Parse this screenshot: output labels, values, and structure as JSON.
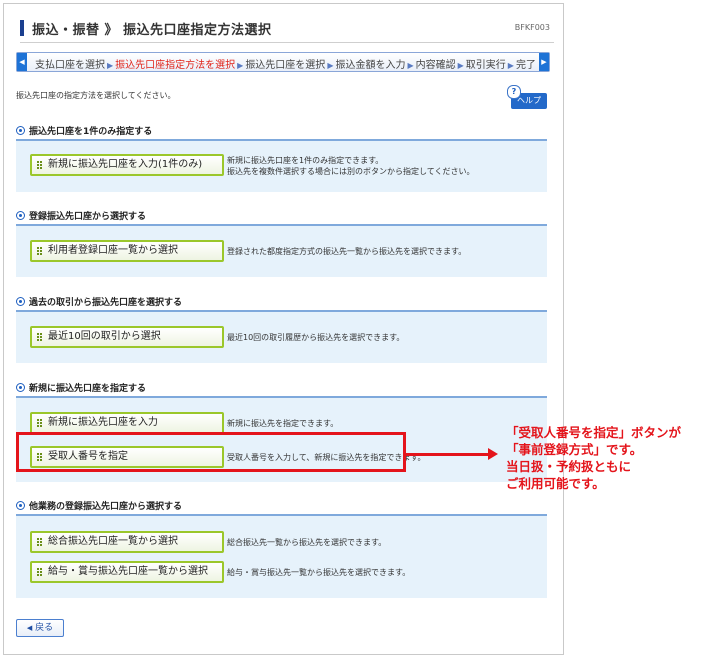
{
  "header": {
    "title": "振込・振替 》 振込先口座指定方法選択",
    "screen_id": "BFKF003"
  },
  "steps": {
    "items": [
      "支払口座を選択",
      "振込先口座指定方法を選択",
      "振込先口座を選択",
      "振込金額を入力",
      "内容確認",
      "取引実行",
      "完了"
    ],
    "current_index": 1,
    "left_arrow": "◀",
    "right_arrow": "▶"
  },
  "instruction": "振込先口座の指定方法を選択してください。",
  "help": {
    "icon_label": "?",
    "label": "ヘルプ"
  },
  "sections": [
    {
      "heading": "振込先口座を1件のみ指定する",
      "options": [
        {
          "label": "新規に振込先口座を入力(1件のみ)",
          "desc_lines": [
            "新規に振込先口座を1件のみ指定できます。",
            "振込先を複数件選択する場合には別のボタンから指定してください。"
          ]
        }
      ]
    },
    {
      "heading": "登録振込先口座から選択する",
      "options": [
        {
          "label": "利用者登録口座一覧から選択",
          "desc_lines": [
            "登録された都度指定方式の振込先一覧から振込先を選択できます。"
          ]
        }
      ]
    },
    {
      "heading": "過去の取引から振込先口座を選択する",
      "options": [
        {
          "label": "最近10回の取引から選択",
          "desc_lines": [
            "最近10回の取引履歴から振込先を選択できます。"
          ]
        }
      ]
    },
    {
      "heading": "新規に振込先口座を指定する",
      "options": [
        {
          "label": "新規に振込先口座を入力",
          "desc_lines": [
            "新規に振込先を指定できます。"
          ]
        },
        {
          "label": "受取人番号を指定",
          "desc_lines": [
            "受取人番号を入力して、新規に振込先を指定できます。"
          ]
        }
      ]
    },
    {
      "heading": "他業務の登録振込先口座から選択する",
      "options": [
        {
          "label": "総合振込先口座一覧から選択",
          "desc_lines": [
            "総合振込先一覧から振込先を選択できます。"
          ]
        },
        {
          "label": "給与・賞与振込先口座一覧から選択",
          "desc_lines": [
            "給与・賞与振込先一覧から振込先を選択できます。"
          ]
        }
      ]
    }
  ],
  "back": {
    "icon": "◀",
    "label": "戻る"
  },
  "annotation": {
    "lines": [
      "「受取人番号を指定」ボタンが",
      "「事前登録方式」です。",
      "当日扱・予約扱ともに",
      "ご利用可能です。"
    ],
    "color": "#e4141b"
  },
  "colors": {
    "accent_blue": "#1e73d6",
    "button_border_green": "#9bc72b",
    "section_bg": "#e6f2fb",
    "current_step": "#e0241a"
  }
}
